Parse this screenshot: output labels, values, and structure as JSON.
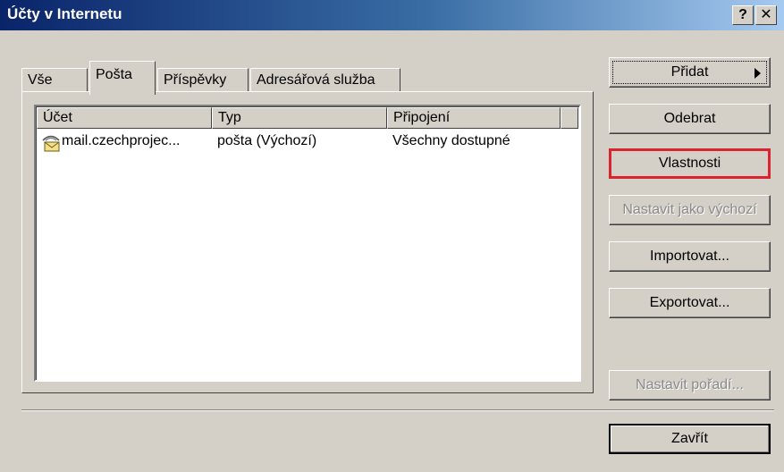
{
  "window": {
    "title": "Účty v Internetu",
    "help_button": "?",
    "close_button": "✕"
  },
  "tabs": [
    {
      "label": "Vše",
      "active": false
    },
    {
      "label": "Pošta",
      "active": true
    },
    {
      "label": "Příspěvky",
      "active": false
    },
    {
      "label": "Adresářová služba",
      "active": false
    }
  ],
  "list": {
    "columns": [
      "Účet",
      "Typ",
      "Připojení"
    ],
    "rows": [
      {
        "account": "mail.czechprojec...",
        "type": "pošta (Výchozí)",
        "connection": "Všechny dostupné"
      }
    ]
  },
  "buttons": {
    "add": "Přidat",
    "remove": "Odebrat",
    "properties": "Vlastnosti",
    "set_default": "Nastavit jako výchozí",
    "import": "Importovat...",
    "export": "Exportovat...",
    "set_order": "Nastavit pořadí...",
    "close": "Zavřít"
  },
  "colors": {
    "title_start": "#0a246a",
    "title_end": "#a6caf0",
    "highlight": "#d9232e",
    "face": "#d4d0c8"
  }
}
